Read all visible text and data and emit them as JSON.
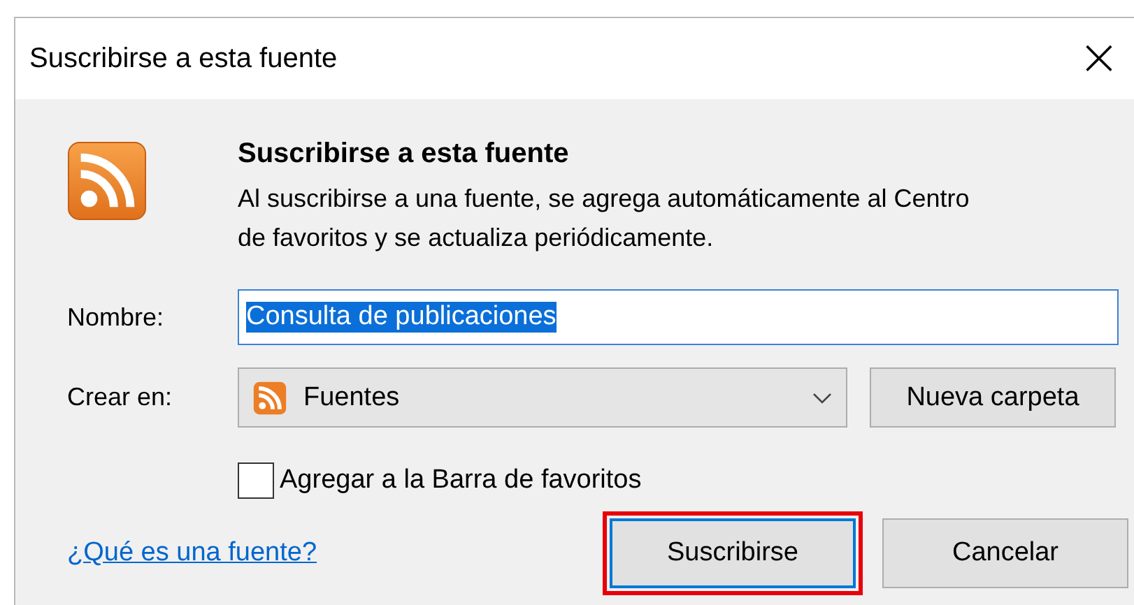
{
  "window": {
    "title": "Suscribirse a esta fuente",
    "close": "×"
  },
  "header": {
    "title": "Suscribirse a esta fuente",
    "description": "Al suscribirse a una fuente, se agrega automáticamente al Centro de favoritos y se actualiza periódicamente."
  },
  "name_field": {
    "label": "Nombre:",
    "value": "Consulta de publicaciones",
    "value_selected": true
  },
  "create_in": {
    "label": "Crear en:",
    "value": "Fuentes",
    "button": "Nueva carpeta"
  },
  "checkbox": {
    "label": "Agregar a la Barra de favoritos",
    "checked": false
  },
  "help_link": "¿Qué es una fuente?",
  "buttons": [
    {
      "label": "Suscribirse",
      "highlighted": true
    },
    {
      "label": "Cancelar",
      "highlighted": false
    }
  ]
}
